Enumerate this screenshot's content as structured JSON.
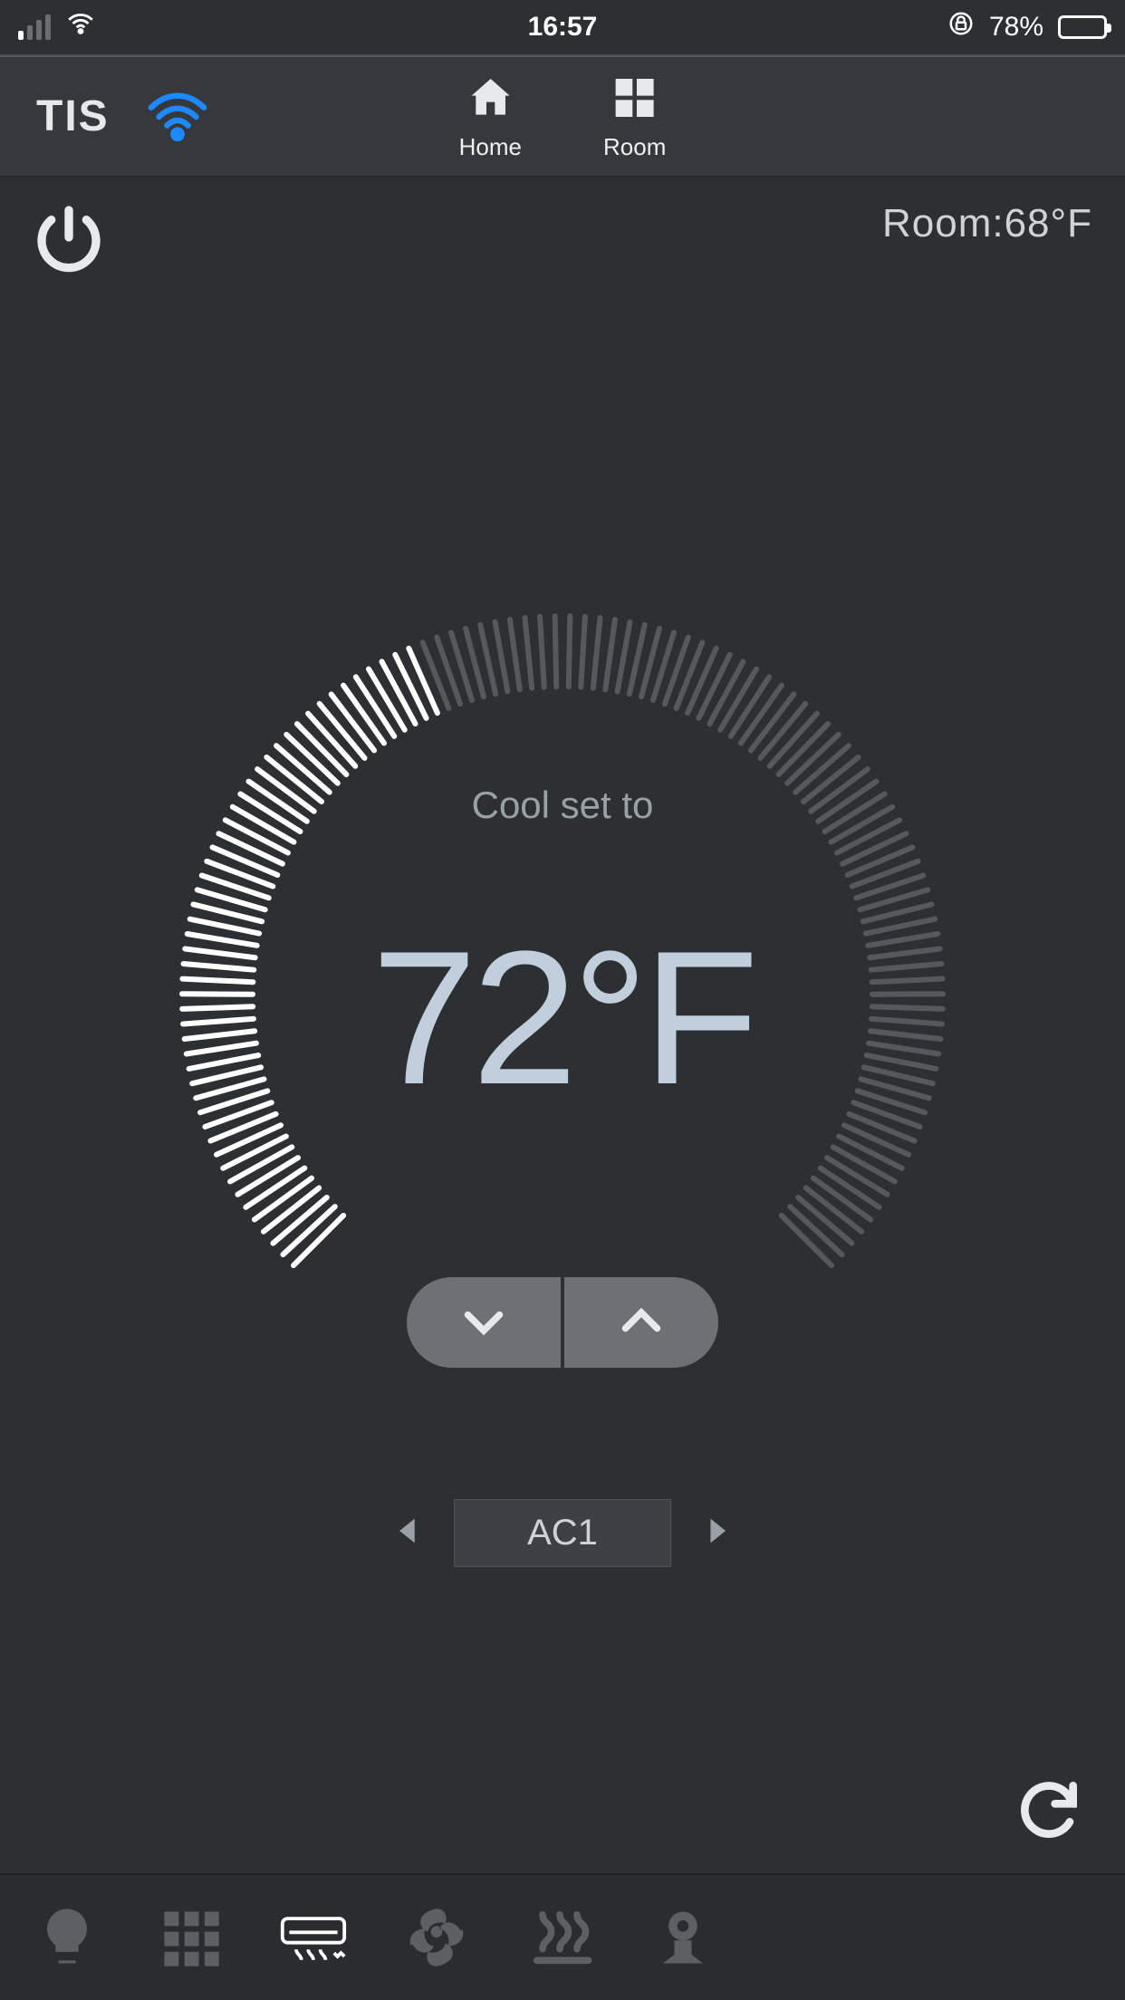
{
  "status_bar": {
    "time": "16:57",
    "battery_pct_text": "78%",
    "battery_pct": 78,
    "wifi_icon": "wifi-icon",
    "orientation_lock_icon": "orientation-lock-icon"
  },
  "nav": {
    "brand": "TIS",
    "wifi_icon": "wifi-icon",
    "items": [
      {
        "label": "Home",
        "icon": "home-icon"
      },
      {
        "label": "Room",
        "icon": "grid-icon"
      }
    ]
  },
  "controls": {
    "power_icon": "power-icon",
    "room_temp_label": "Room:",
    "room_temp_value": "68°F"
  },
  "dial": {
    "mode_label": "Cool set to",
    "set_temp": "72°F",
    "progress_ratio": 0.42,
    "decrease_icon": "chevron-down-icon",
    "increase_icon": "chevron-up-icon"
  },
  "device_selector": {
    "prev_icon": "triangle-left-icon",
    "next_icon": "triangle-right-icon",
    "current": "AC1"
  },
  "footer": {
    "refresh_icon": "refresh-icon"
  },
  "tabs": [
    {
      "name": "light",
      "icon": "bulb-icon",
      "active": false
    },
    {
      "name": "grid",
      "icon": "grid-icon",
      "active": false
    },
    {
      "name": "ac",
      "icon": "ac-unit-icon",
      "active": true
    },
    {
      "name": "fan",
      "icon": "fan-icon",
      "active": false
    },
    {
      "name": "heat",
      "icon": "heat-waves-icon",
      "active": false
    },
    {
      "name": "camera",
      "icon": "camera-icon",
      "active": false
    }
  ],
  "colors": {
    "bg": "#2d3033",
    "accent_blue": "#1e88ff",
    "tick_active": "#ffffff",
    "tick_inactive": "#55595d",
    "temp_text": "#c1cedb"
  }
}
